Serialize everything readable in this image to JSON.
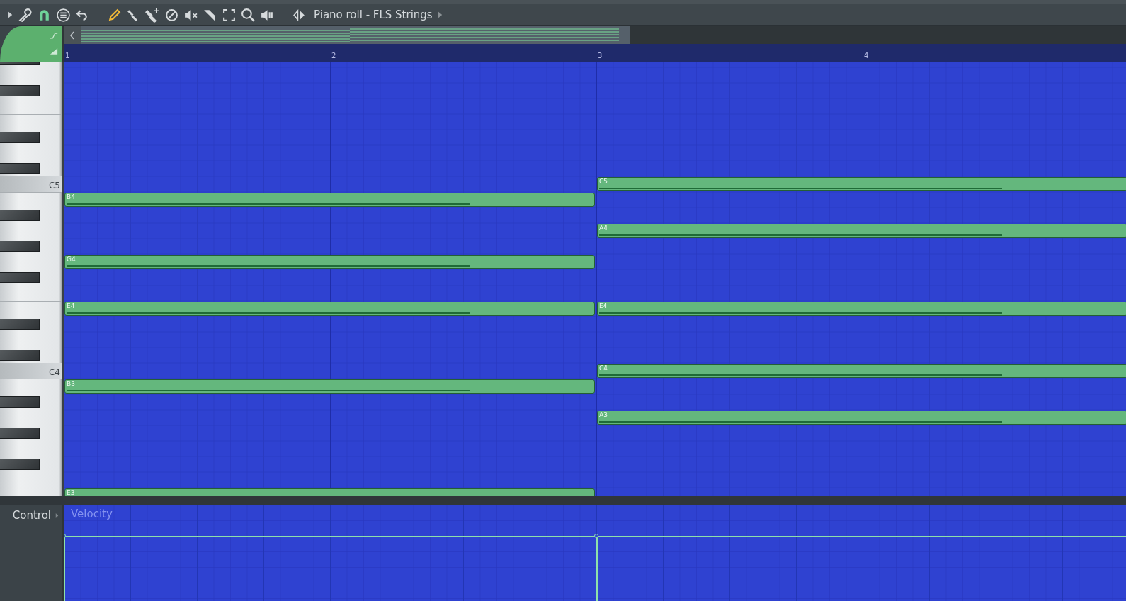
{
  "window": {
    "title": "Piano roll - FLS Strings"
  },
  "ruler": [
    "1",
    "2",
    "3",
    "4"
  ],
  "keyboard": {
    "c_labels": [
      "C5",
      "C4"
    ]
  },
  "chords": [
    {
      "level": 0.76,
      "notes": [
        {
          "label": "B4"
        },
        {
          "label": "G4"
        },
        {
          "label": "E4"
        },
        {
          "label": "B3"
        },
        {
          "label": "E3"
        }
      ]
    },
    {
      "level": 0.76,
      "notes": [
        {
          "label": "C5"
        },
        {
          "label": "A4"
        },
        {
          "label": "E4"
        },
        {
          "label": "C4"
        },
        {
          "label": "A3"
        }
      ]
    }
  ],
  "control": {
    "label": "Control",
    "parameter": "Velocity"
  }
}
